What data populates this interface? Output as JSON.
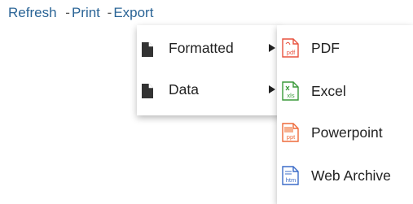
{
  "toolbar": {
    "refresh_label": "Refresh",
    "print_label": "Print",
    "export_label": "Export",
    "separator": "-"
  },
  "export_menu": {
    "items": [
      {
        "label": "Formatted",
        "icon": "document-icon",
        "has_submenu": true
      },
      {
        "label": "Data",
        "icon": "document-icon",
        "has_submenu": true
      }
    ]
  },
  "formatted_submenu": {
    "items": [
      {
        "label": "PDF",
        "icon": "pdf-file-icon",
        "badge": "pdf",
        "color": "#e8523f"
      },
      {
        "label": "Excel",
        "icon": "excel-file-icon",
        "badge": "xls",
        "color": "#3a9a3a"
      },
      {
        "label": "Powerpoint",
        "icon": "powerpoint-file-icon",
        "badge": "ppt",
        "color": "#ee6a3a"
      },
      {
        "label": "Web Archive",
        "icon": "web-archive-file-icon",
        "badge": "htm",
        "color": "#3b6cc8"
      }
    ]
  },
  "colors": {
    "link": "#2a6496",
    "text": "#222222",
    "icon_dark": "#333333"
  }
}
